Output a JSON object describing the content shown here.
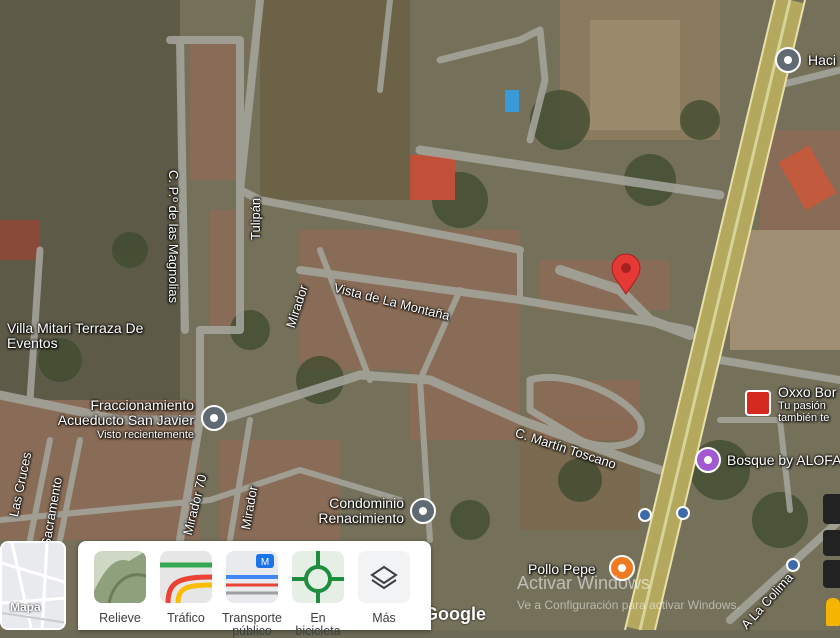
{
  "streets": {
    "vista_montana": "Vista de La Montaña",
    "magnolias": "C. P.º de las Magnolias",
    "tulipan": "Tulipán",
    "mirador_top": "Mirador",
    "martin_toscano": "C. Martín Toscano",
    "las_cruces": "Las Cruces",
    "sacramento": "Sacramento",
    "mirador_70": "Mirador 70",
    "mirador_bottom": "Mirador",
    "la_colima": "A La Colima"
  },
  "places": {
    "villa_mitari": "Villa Mitari Terraza De Eventos",
    "fraccionamiento_line1": "Fraccionamiento",
    "fraccionamiento_line2": "Acueducto San Javier",
    "visto": "Visto recientemente",
    "condominio_line1": "Condominio",
    "condominio_line2": "Renacimiento",
    "pollo_pepe": "Pollo Pepe",
    "bosque": "Bosque by ALOFA",
    "oxxo": "Oxxo Bor",
    "oxxo_sub1": "Tu pasión",
    "oxxo_sub2": "también te",
    "hacienda": "Haci"
  },
  "layers": [
    {
      "label": "Relieve",
      "icon": "terrain-icon"
    },
    {
      "label": "Tráfico",
      "icon": "traffic-icon"
    },
    {
      "label": "Transporte público",
      "icon": "transit-icon"
    },
    {
      "label": "En bicicleta",
      "icon": "bicycle-icon"
    },
    {
      "label": "Más",
      "icon": "layers-icon"
    }
  ],
  "map_type": "Mapa",
  "watermark": {
    "line1": "Activar Windows",
    "line2": "Ve a Configuración para activar Windows."
  },
  "google": "Google"
}
